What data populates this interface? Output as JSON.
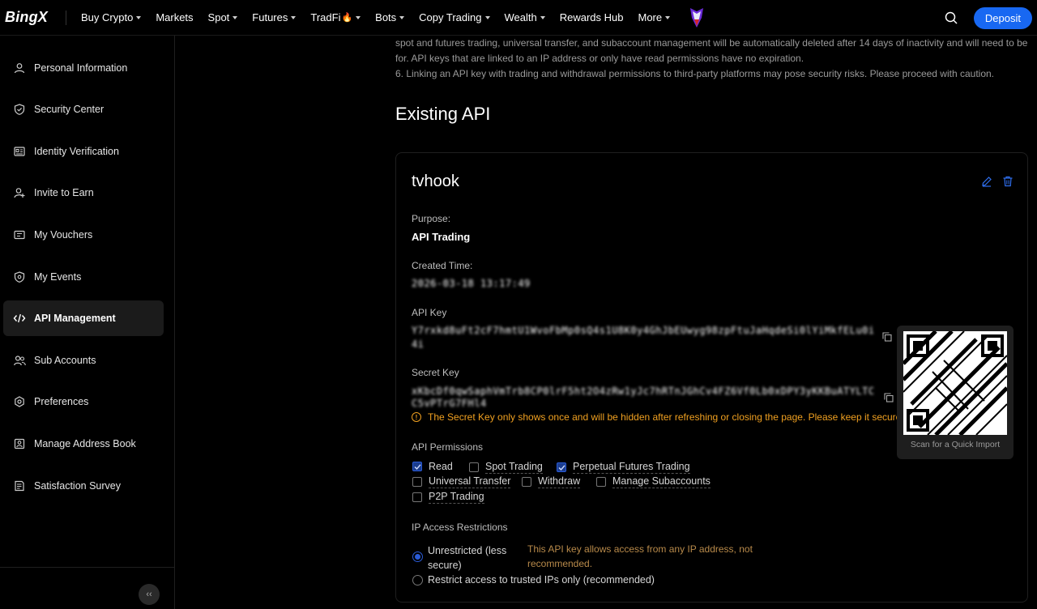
{
  "nav": {
    "logo": "BingX",
    "items": [
      {
        "label": "Buy Crypto",
        "caret": true
      },
      {
        "label": "Markets",
        "caret": false
      },
      {
        "label": "Spot",
        "caret": true
      },
      {
        "label": "Futures",
        "caret": true
      },
      {
        "label": "TradFi",
        "caret": true,
        "badge": "🔥"
      },
      {
        "label": "Bots",
        "caret": true
      },
      {
        "label": "Copy Trading",
        "caret": true
      },
      {
        "label": "Wealth",
        "caret": true
      },
      {
        "label": "Rewards Hub",
        "caret": false
      },
      {
        "label": "More",
        "caret": true
      }
    ],
    "deposit_label": "Deposit"
  },
  "sidebar": {
    "items": [
      {
        "label": "Personal Information",
        "icon": "user-icon"
      },
      {
        "label": "Security Center",
        "icon": "shield-icon"
      },
      {
        "label": "Identity Verification",
        "icon": "id-card-icon"
      },
      {
        "label": "Invite to Earn",
        "icon": "add-user-icon"
      },
      {
        "label": "My Vouchers",
        "icon": "voucher-icon"
      },
      {
        "label": "My Events",
        "icon": "event-icon"
      },
      {
        "label": "API Management",
        "icon": "code-icon",
        "active": true
      },
      {
        "label": "Sub Accounts",
        "icon": "users-icon"
      },
      {
        "label": "Preferences",
        "icon": "settings-icon"
      },
      {
        "label": "Manage Address Book",
        "icon": "address-book-icon"
      },
      {
        "label": "Satisfaction Survey",
        "icon": "survey-icon"
      }
    ],
    "collapse_label": "‹‹"
  },
  "notes": {
    "line1": "spot and futures trading, universal transfer, and subaccount management will be automatically deleted after 14 days of inactivity and will need to be reapplied",
    "line2": "for. API keys that are linked to an IP address or only have read permissions have no expiration.",
    "line3": "6. Linking an API key with trading and withdrawal permissions to third-party platforms may pose security risks. Please proceed with caution."
  },
  "existing": {
    "title": "Existing API",
    "card": {
      "name": "tvhook",
      "purpose_label": "Purpose:",
      "purpose_value": "API Trading",
      "created_label": "Created Time:",
      "created_value": "2026-03-18 13:17:49",
      "api_key_label": "API Key",
      "api_key_line1": "Y7rxkd8uFt2cF7hmtU1WvoFbMp0sQ4s1U8K0y4GhJbEUwyg98zpFtuJaHqdeSi0lYiMkfELu0i5vTt4b",
      "api_key_line2": "4i",
      "secret_label": "Secret Key",
      "secret_line1": "xKbcDf0qwSaphVmTrb8CP0lrF5ht2O4zRw1yJc7hRTnJGhCv4FZ6Vf0Lb0xDPY3yKKBuATYLTCHZ",
      "secret_line2": "C5vPTrG7FHl4",
      "warning": "The Secret Key only shows once and will be hidden after refreshing or closing the page. Please keep it securely",
      "qr_caption": "Scan for a Quick Import",
      "permissions_label": "API Permissions",
      "permissions": [
        {
          "label": "Read",
          "checked": true
        },
        {
          "label": "Spot Trading",
          "checked": false
        },
        {
          "label": "Perpetual Futures Trading",
          "checked": true
        },
        {
          "label": "Universal Transfer",
          "checked": false
        },
        {
          "label": "Withdraw",
          "checked": false
        },
        {
          "label": "Manage Subaccounts",
          "checked": false
        },
        {
          "label": "P2P Trading",
          "checked": false
        }
      ],
      "ip_label": "IP Access Restrictions",
      "ip_unrestricted_line1": "Unrestricted (less",
      "ip_unrestricted_line2": "secure)",
      "ip_unrestricted_desc": "This API key allows access from any IP address, not recommended.",
      "ip_restricted": "Restrict access to trusted IPs only (recommended)"
    }
  },
  "colors": {
    "accent": "#1868f2",
    "warning": "#f0a020",
    "desc": "#b88a4a"
  }
}
